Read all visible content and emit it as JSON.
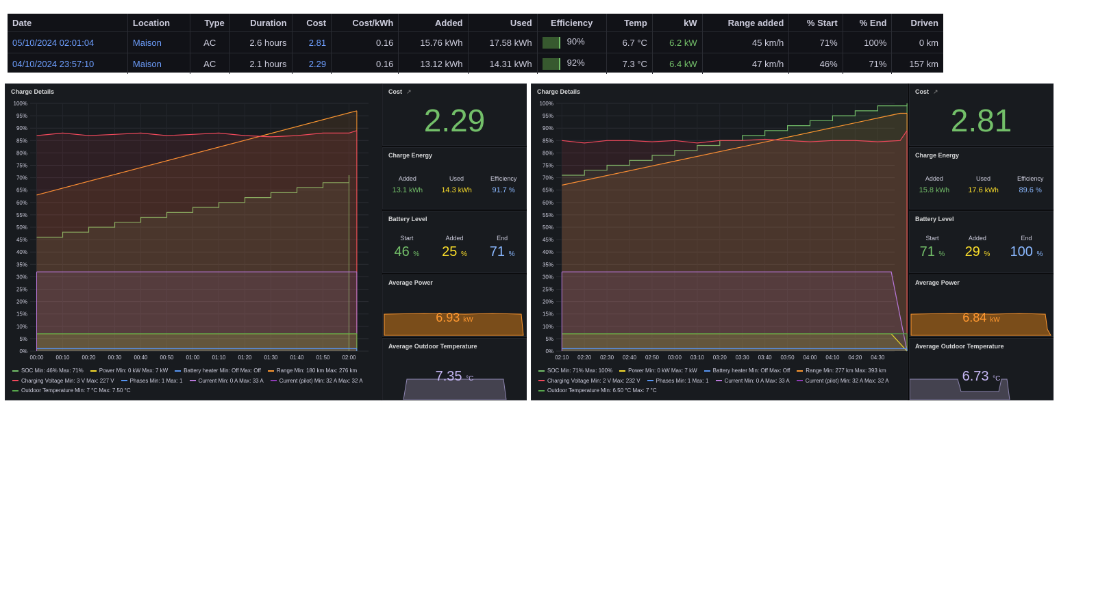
{
  "table": {
    "headers": [
      "Date",
      "Location",
      "Type",
      "Duration",
      "Cost",
      "Cost/kWh",
      "Added",
      "Used",
      "Efficiency",
      "Temp",
      "kW",
      "Range added",
      "% Start",
      "% End",
      "Driven"
    ],
    "rows": [
      {
        "date": "05/10/2024 02:01:04",
        "location": "Maison",
        "type": "AC",
        "duration": "2.6 hours",
        "cost": "2.81",
        "cost_kwh": "0.16",
        "added": "15.76 kWh",
        "used": "17.58 kWh",
        "efficiency": "90%",
        "temp": "6.7 °C",
        "kw": "6.2 kW",
        "range_added": "45 km/h",
        "start": "71%",
        "end": "100%",
        "driven": "0 km"
      },
      {
        "date": "04/10/2024 23:57:10",
        "location": "Maison",
        "type": "AC",
        "duration": "2.1 hours",
        "cost": "2.29",
        "cost_kwh": "0.16",
        "added": "13.12 kWh",
        "used": "14.31 kWh",
        "efficiency": "92%",
        "temp": "7.3 °C",
        "kw": "6.4 kW",
        "range_added": "47 km/h",
        "start": "46%",
        "end": "71%",
        "driven": "157 km"
      }
    ]
  },
  "dashboards": [
    {
      "chart_title": "Charge Details",
      "cost_title": "Cost",
      "cost": "2.29",
      "energy_title": "Charge Energy",
      "energy": {
        "added_label": "Added",
        "added": "13.1",
        "used_label": "Used",
        "used": "14.3",
        "eff_label": "Efficiency",
        "eff": "91.7",
        "unit_kwh": "kWh",
        "unit_pct": "%"
      },
      "battery_title": "Battery Level",
      "battery": {
        "start_label": "Start",
        "start": "46",
        "added_label": "Added",
        "added": "25",
        "end_label": "End",
        "end": "71",
        "unit": "%"
      },
      "power_title": "Average Power",
      "power": "6.93",
      "power_unit": "kW",
      "temp_title": "Average Outdoor Temperature",
      "temp": "7.35",
      "temp_unit": "°C",
      "legend": [
        {
          "text": "SOC  Min: 46%  Max: 71%",
          "color": "#73bf69"
        },
        {
          "text": "Power  Min: 0 kW  Max: 7 kW",
          "color": "#fade2a"
        },
        {
          "text": "Battery heater  Min: Off  Max: Off",
          "color": "#5794f2"
        },
        {
          "text": "Range  Min: 180 km  Max: 276 km",
          "color": "#ff9830"
        },
        {
          "text": "Charging Voltage  Min: 3 V  Max: 227 V",
          "color": "#f2495c"
        },
        {
          "text": "Phases  Min: 1  Max: 1",
          "color": "#5794f2"
        },
        {
          "text": "Current  Min: 0 A  Max: 33 A",
          "color": "#b877d9"
        },
        {
          "text": "Current (pilot)  Min: 32 A  Max: 32 A",
          "color": "#8f3bb8"
        },
        {
          "text": "Outdoor Temperature  Min: 7 °C  Max: 7.50 °C",
          "color": "#56a64b"
        }
      ],
      "chart_data": {
        "type": "line",
        "x_ticks": [
          "00:00",
          "00:10",
          "00:20",
          "00:30",
          "00:40",
          "00:50",
          "01:00",
          "01:10",
          "01:20",
          "01:30",
          "01:40",
          "01:50",
          "02:00"
        ],
        "y_ticks": [
          "0%",
          "5%",
          "10%",
          "15%",
          "20%",
          "25%",
          "30%",
          "35%",
          "40%",
          "45%",
          "50%",
          "55%",
          "60%",
          "65%",
          "70%",
          "75%",
          "80%",
          "85%",
          "90%",
          "95%",
          "100%"
        ],
        "ylim": [
          0,
          100
        ],
        "series": [
          {
            "name": "SOC",
            "color": "#73bf69",
            "x": [
              0,
              1,
              2,
              3,
              4,
              5,
              6,
              7,
              8,
              9,
              10,
              11,
              12
            ],
            "values": [
              46,
              48,
              50,
              52,
              54,
              56,
              58,
              60,
              62,
              64,
              66,
              68,
              71
            ],
            "stepped": true
          },
          {
            "name": "Range",
            "color": "#ff9830",
            "x": [
              0,
              12.3
            ],
            "values": [
              63,
              97
            ]
          },
          {
            "name": "Charging Voltage",
            "color": "#f2495c",
            "x": [
              0,
              1,
              2,
              3,
              4,
              5,
              6,
              7,
              8,
              9,
              10,
              11,
              12,
              12.3
            ],
            "values": [
              87,
              88,
              87,
              87.5,
              88,
              87,
              87.5,
              88,
              87,
              86.5,
              87,
              88,
              88,
              89
            ]
          },
          {
            "name": "Current",
            "color": "#b877d9",
            "x": [
              0,
              12.3
            ],
            "values": [
              32,
              32
            ]
          },
          {
            "name": "Power",
            "color": "#fade2a",
            "x": [
              0,
              12.3
            ],
            "values": [
              7,
              7
            ]
          },
          {
            "name": "Outdoor Temperature",
            "color": "#56a64b",
            "x": [
              0,
              12.3
            ],
            "values": [
              7,
              7
            ]
          },
          {
            "name": "Phases",
            "color": "#5794f2",
            "x": [
              0,
              12.3
            ],
            "values": [
              1,
              1
            ]
          }
        ]
      }
    },
    {
      "chart_title": "Charge Details",
      "cost_title": "Cost",
      "cost": "2.81",
      "energy_title": "Charge Energy",
      "energy": {
        "added_label": "Added",
        "added": "15.8",
        "used_label": "Used",
        "used": "17.6",
        "eff_label": "Efficiency",
        "eff": "89.6",
        "unit_kwh": "kWh",
        "unit_pct": "%"
      },
      "battery_title": "Battery Level",
      "battery": {
        "start_label": "Start",
        "start": "71",
        "added_label": "Added",
        "added": "29",
        "end_label": "End",
        "end": "100",
        "unit": "%"
      },
      "power_title": "Average Power",
      "power": "6.84",
      "power_unit": "kW",
      "temp_title": "Average Outdoor Temperature",
      "temp": "6.73",
      "temp_unit": "°C",
      "legend": [
        {
          "text": "SOC  Min: 71%  Max: 100%",
          "color": "#73bf69"
        },
        {
          "text": "Power  Min: 0 kW  Max: 7 kW",
          "color": "#fade2a"
        },
        {
          "text": "Battery heater  Min: Off  Max: Off",
          "color": "#5794f2"
        },
        {
          "text": "Range  Min: 277 km  Max: 393 km",
          "color": "#ff9830"
        },
        {
          "text": "Charging Voltage  Min: 2 V  Max: 232 V",
          "color": "#f2495c"
        },
        {
          "text": "Phases  Min: 1  Max: 1",
          "color": "#5794f2"
        },
        {
          "text": "Current  Min: 0 A  Max: 33 A",
          "color": "#b877d9"
        },
        {
          "text": "Current (pilot)  Min: 32 A  Max: 32 A",
          "color": "#8f3bb8"
        },
        {
          "text": "Outdoor Temperature  Min: 6.50 °C  Max: 7 °C",
          "color": "#56a64b"
        }
      ],
      "chart_data": {
        "type": "line",
        "x_ticks": [
          "02:10",
          "02:20",
          "02:30",
          "02:40",
          "02:50",
          "03:00",
          "03:10",
          "03:20",
          "03:30",
          "03:40",
          "03:50",
          "04:00",
          "04:10",
          "04:20",
          "04:30"
        ],
        "y_ticks": [
          "0%",
          "5%",
          "10%",
          "15%",
          "20%",
          "25%",
          "30%",
          "35%",
          "40%",
          "45%",
          "50%",
          "55%",
          "60%",
          "65%",
          "70%",
          "75%",
          "80%",
          "85%",
          "90%",
          "95%",
          "100%"
        ],
        "ylim": [
          0,
          100
        ],
        "series": [
          {
            "name": "SOC",
            "color": "#73bf69",
            "x": [
              0,
              1,
              2,
              3,
              4,
              5,
              6,
              7,
              8,
              9,
              10,
              11,
              12,
              13,
              14,
              15.3
            ],
            "values": [
              71,
              73,
              75,
              77,
              79,
              81,
              83,
              85,
              87,
              89,
              91,
              93,
              95,
              97,
              99,
              100
            ],
            "stepped": true
          },
          {
            "name": "Range",
            "color": "#ff9830",
            "x": [
              0,
              15,
              15.3
            ],
            "values": [
              67,
              96,
              96
            ]
          },
          {
            "name": "Charging Voltage",
            "color": "#f2495c",
            "x": [
              0,
              1,
              2,
              3,
              4,
              5,
              6,
              7,
              8,
              9,
              10,
              11,
              12,
              13,
              14,
              15,
              15.3
            ],
            "values": [
              85,
              84,
              85,
              85,
              84.5,
              85,
              84,
              85,
              85,
              85.5,
              85,
              84.5,
              85,
              85,
              84.5,
              85,
              89
            ]
          },
          {
            "name": "Current",
            "color": "#b877d9",
            "x": [
              0,
              14.6,
              15.3
            ],
            "values": [
              32,
              32,
              0
            ]
          },
          {
            "name": "Power",
            "color": "#fade2a",
            "x": [
              0,
              14.6,
              15.3
            ],
            "values": [
              7,
              7,
              0
            ]
          },
          {
            "name": "Outdoor Temperature",
            "color": "#56a64b",
            "x": [
              0,
              15.3
            ],
            "values": [
              7,
              7
            ]
          },
          {
            "name": "Phases",
            "color": "#5794f2",
            "x": [
              0,
              15.3
            ],
            "values": [
              1,
              1
            ]
          }
        ]
      }
    }
  ]
}
